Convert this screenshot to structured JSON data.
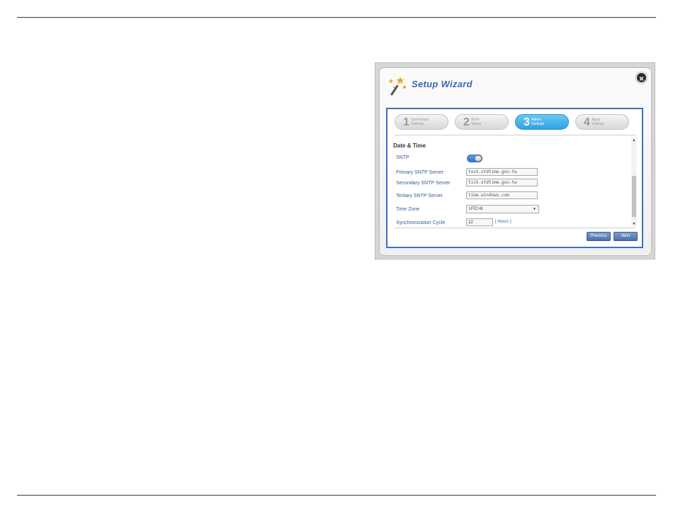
{
  "wizard": {
    "title": "Setup Wizard",
    "close_label": "×"
  },
  "steps": [
    {
      "number": "1",
      "label_line1": "Connection",
      "label_line2": "Settings",
      "active": false
    },
    {
      "number": "2",
      "label_line1": "Wi-Fi",
      "label_line2": "Status",
      "active": false
    },
    {
      "number": "3",
      "label_line1": "Admin",
      "label_line2": "Settings",
      "active": true
    },
    {
      "number": "4",
      "label_line1": "Apply",
      "label_line2": "Settings",
      "active": false
    }
  ],
  "section": {
    "title": "Date & Time"
  },
  "form": {
    "sntp_label": "SNTP",
    "sntp_enabled": true,
    "primary_label": "Primary SNTP Server",
    "primary_value": "tock.stdtime.gov.tw",
    "secondary_label": "Secondary SNTP Server",
    "secondary_value": "tick.stdtime.gov.tw",
    "tertiary_label": "Tertiary SNTP Server",
    "tertiary_value": "time.windows.com",
    "timezone_label": "Time Zone",
    "timezone_value": "UTC+8",
    "cycle_label": "Synchronization Cycle",
    "cycle_value": "12",
    "cycle_unit": "[ Hours ]"
  },
  "buttons": {
    "previous": "Previous",
    "next": "Next"
  },
  "icons": {
    "wizard": "magic-wand-icon",
    "close": "close-icon",
    "dropdown": "chevron-down-icon",
    "scroll_up": "arrow-up-icon",
    "scroll_down": "arrow-down-icon"
  },
  "colors": {
    "accent": "#3b68b0",
    "active_step": "#2fa4e3",
    "panel_border": "#3f6fc2",
    "button": "#4b6fa8"
  }
}
